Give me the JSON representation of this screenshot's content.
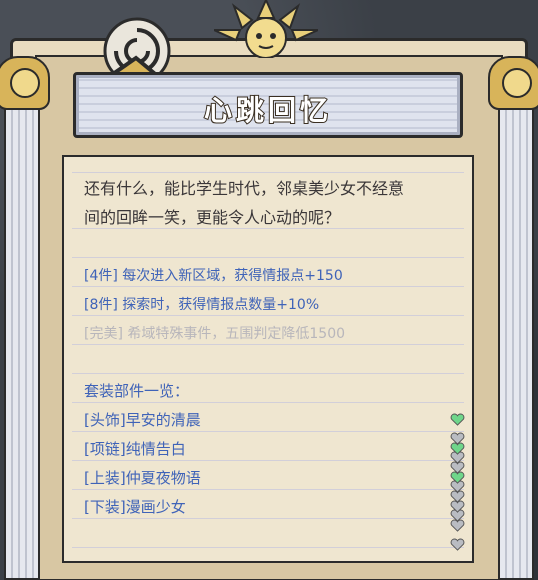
{
  "title": "心跳回忆",
  "description": [
    "还有什么，能比学生时代，邻桌美少女不经意",
    "间的回眸一笑，更能令人心动的呢？"
  ],
  "bonuses": [
    {
      "text": "[4件]  每次进入新区域，获得情报点+150",
      "active": true
    },
    {
      "text": "[8件]  探索时，获得情报点数量+10%",
      "active": true
    },
    {
      "text": "[完美] 希域特殊事件，五围判定降低1500",
      "active": false
    }
  ],
  "parts_title": "套装部件一览：",
  "parts": [
    {
      "slot": "[头饰]",
      "name": "早安的清晨",
      "filled": 1
    },
    {
      "slot": "[项链]",
      "name": "纯情告白",
      "filled": 1
    },
    {
      "slot": "[上装]",
      "name": "仲夏夜物语",
      "filled": 1
    },
    {
      "slot": "[下装]",
      "name": "漫画少女",
      "filled": 0
    }
  ],
  "colors": {
    "accent_text": "#3f63b8",
    "heart_filled": "#6fd68a",
    "heart_empty": "#b9bcc2"
  },
  "icons": {
    "emblem": "spiral-emblem-icon",
    "sun": "sun-ornament-icon",
    "heart_filled": "green-heart-icon",
    "heart_empty": "gray-heart-icon"
  }
}
